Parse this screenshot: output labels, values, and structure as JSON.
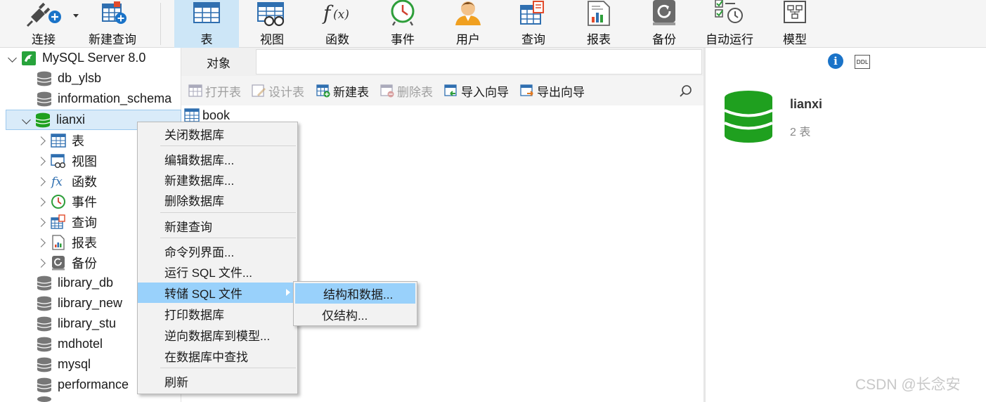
{
  "toolbar": {
    "buttons": [
      {
        "label": "连接",
        "icon": "plug-icon"
      },
      {
        "label": "新建查询",
        "icon": "new-query-icon"
      },
      {
        "label": "表",
        "icon": "table-icon",
        "active": true
      },
      {
        "label": "视图",
        "icon": "view-icon"
      },
      {
        "label": "函数",
        "icon": "function-icon"
      },
      {
        "label": "事件",
        "icon": "clock-icon"
      },
      {
        "label": "用户",
        "icon": "user-icon"
      },
      {
        "label": "查询",
        "icon": "query-icon"
      },
      {
        "label": "报表",
        "icon": "report-icon"
      },
      {
        "label": "备份",
        "icon": "backup-icon"
      },
      {
        "label": "自动运行",
        "icon": "schedule-icon"
      },
      {
        "label": "模型",
        "icon": "model-icon"
      }
    ]
  },
  "tree": {
    "server": "MySQL Server 8.0",
    "databases_before": [
      "db_ylsb",
      "information_schema"
    ],
    "selected_db": "lianxi",
    "children": [
      {
        "label": "表",
        "icon": "table-icon"
      },
      {
        "label": "视图",
        "icon": "view-icon"
      },
      {
        "label": "函数",
        "icon": "function-icon"
      },
      {
        "label": "事件",
        "icon": "clock-icon"
      },
      {
        "label": "查询",
        "icon": "query-icon"
      },
      {
        "label": "报表",
        "icon": "report-icon"
      },
      {
        "label": "备份",
        "icon": "backup-icon"
      }
    ],
    "databases_after": [
      "library_db",
      "library_new",
      "library_stu",
      "mdhotel",
      "mysql",
      "performance"
    ]
  },
  "object_panel": {
    "tab": "对象",
    "actions": [
      {
        "label": "打开表",
        "enabled": false
      },
      {
        "label": "设计表",
        "enabled": false
      },
      {
        "label": "新建表",
        "enabled": true
      },
      {
        "label": "删除表",
        "enabled": false
      },
      {
        "label": "导入向导",
        "enabled": true
      },
      {
        "label": "导出向导",
        "enabled": true
      }
    ],
    "items": [
      "book"
    ]
  },
  "info_panel": {
    "db_name": "lianxi",
    "table_count": "2 表",
    "info_button": "i",
    "ddl_button": "DDL"
  },
  "context_menu": {
    "items": [
      "关闭数据库",
      "编辑数据库...",
      "新建数据库...",
      "删除数据库",
      "新建查询",
      "命令列界面...",
      "运行 SQL 文件...",
      "转储 SQL 文件",
      "打印数据库",
      "逆向数据库到模型...",
      "在数据库中查找",
      "刷新"
    ],
    "highlighted": "转储 SQL 文件"
  },
  "submenu": {
    "items": [
      "结构和数据...",
      "仅结构..."
    ],
    "highlighted": "结构和数据..."
  },
  "watermark": "CSDN @长念安",
  "colors": {
    "accent": "#99d1fb",
    "db_green": "#1fa01f",
    "toolbar_active": "#cde6f7"
  }
}
